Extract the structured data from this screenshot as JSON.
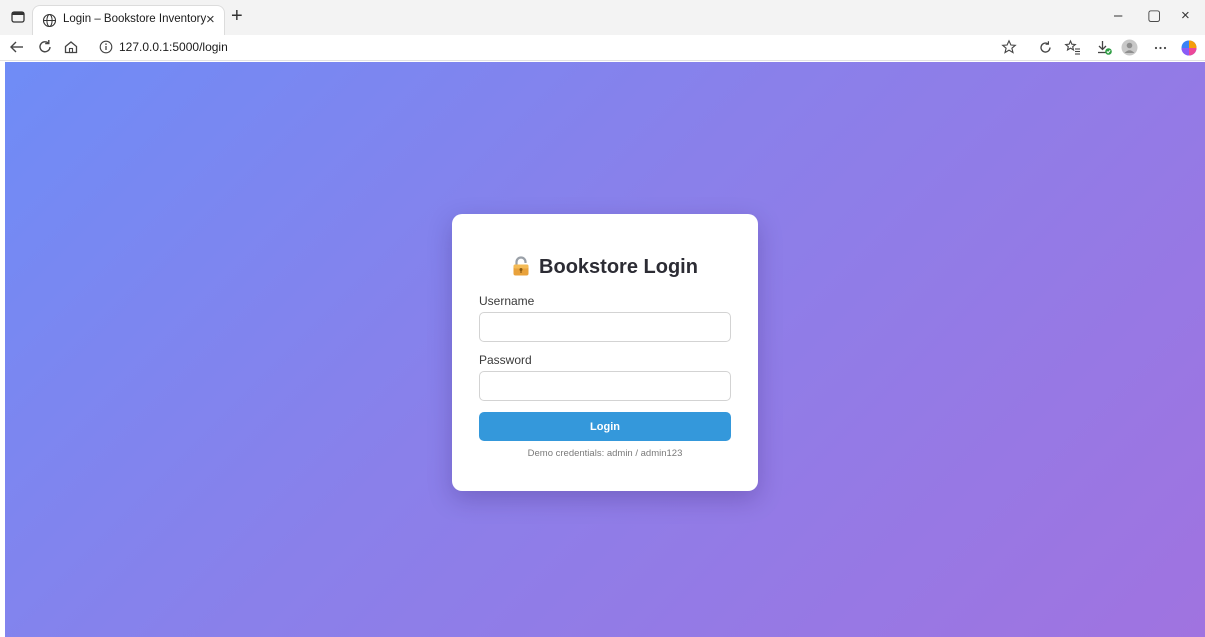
{
  "browser": {
    "tab_title": "Login – Bookstore Inventory",
    "tab_close": "×",
    "new_tab": "+",
    "url": "127.0.0.1:5000/login",
    "window_controls": {
      "minimize": "–",
      "maximize": "▢",
      "close": "×"
    },
    "icons": [
      "sidebar-toggle-icon",
      "globe-icon",
      "back-icon",
      "reload-icon",
      "home-icon",
      "info-icon",
      "star-icon",
      "refresh-icon",
      "favorites-icon",
      "downloads-icon",
      "profile-icon",
      "more-icon",
      "copilot-icon"
    ]
  },
  "login": {
    "icon": "lock-icon",
    "heading": "Bookstore Login",
    "username_label": "Username",
    "username_value": "",
    "password_label": "Password",
    "password_value": "",
    "submit_label": "Login",
    "demo_note": "Demo credentials: admin / admin123"
  },
  "colors": {
    "gradient_start": "#6f8cf6",
    "gradient_end": "#a073e0",
    "button": "#3498db",
    "card": "#ffffff"
  }
}
